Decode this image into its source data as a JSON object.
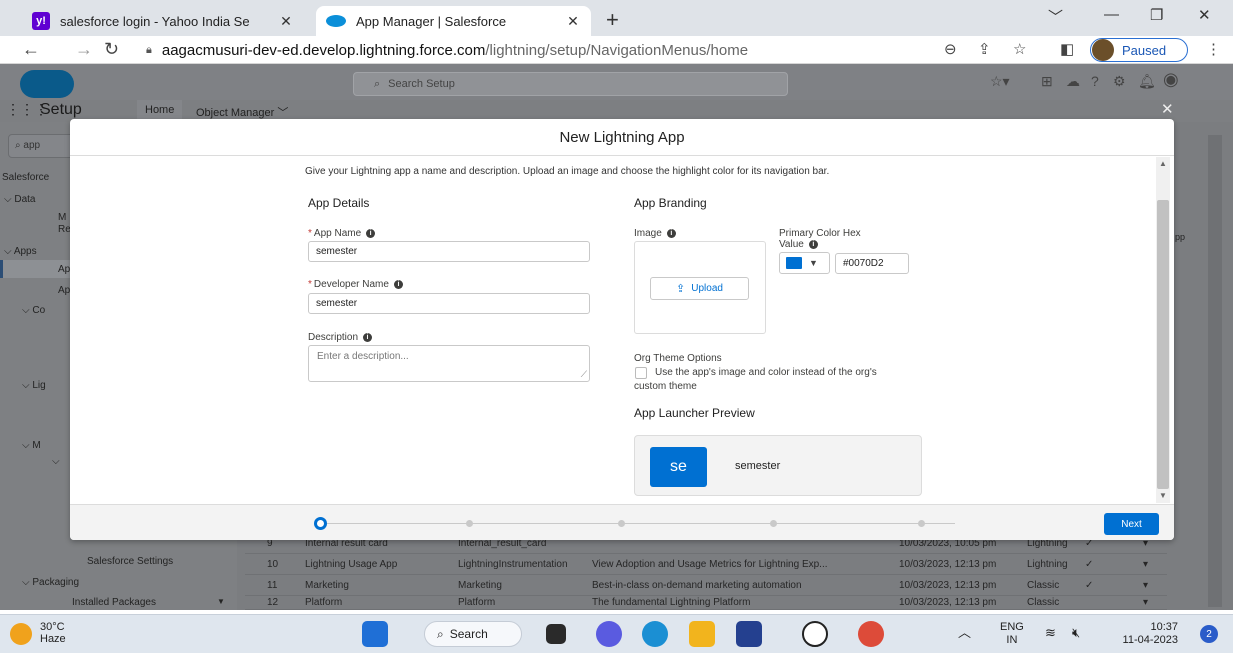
{
  "browser": {
    "tabs": [
      {
        "title": "salesforce login - Yahoo India Se",
        "favicon": "yahoo-icon"
      },
      {
        "title": "App Manager | Salesforce",
        "favicon": "salesforce-icon"
      }
    ],
    "url_host": "aagacmusuri-dev-ed.develop.lightning.force.com",
    "url_path": "/lightning/setup/NavigationMenus/home",
    "profile_status": "Paused"
  },
  "salesforce": {
    "search_placeholder": "Search Setup",
    "app_name": "Setup",
    "nav_tabs": [
      "Home",
      "Object Manager"
    ],
    "sidebar": {
      "search_value": "app",
      "breadcrumb": "Salesforce",
      "items": [
        {
          "label": "Data"
        },
        {
          "label": "M"
        },
        {
          "label": "Re"
        },
        {
          "label": "Apps"
        },
        {
          "label": "Ap"
        },
        {
          "label": "Ap"
        },
        {
          "label": "Co"
        },
        {
          "label": "Lig"
        },
        {
          "label": "M"
        },
        {
          "label": "Salesforce Settings"
        },
        {
          "label": "Packaging"
        },
        {
          "label": "Installed Packages"
        }
      ]
    },
    "table_rows": [
      {
        "num": "9",
        "label": "Internal result card",
        "api": "Internal_result_card",
        "desc": "",
        "date": "10/03/2023, 10:05 pm",
        "type": "Lightning",
        "check": "✓"
      },
      {
        "num": "10",
        "label": "Lightning Usage App",
        "api": "LightningInstrumentation",
        "desc": "View Adoption and Usage Metrics for Lightning Exp...",
        "date": "10/03/2023, 12:13 pm",
        "type": "Lightning",
        "check": "✓"
      },
      {
        "num": "11",
        "label": "Marketing",
        "api": "Marketing",
        "desc": "Best-in-class on-demand marketing automation",
        "date": "10/03/2023, 12:13 pm",
        "type": "Classic",
        "check": "✓"
      },
      {
        "num": "12",
        "label": "Platform",
        "api": "Platform",
        "desc": "The fundamental Lightning Platform",
        "date": "10/03/2023, 12:13 pm",
        "type": "Classic",
        "check": ""
      }
    ],
    "right_peek": "pp"
  },
  "modal": {
    "title": "New Lightning App",
    "description": "Give your Lightning app a name and description. Upload an image and choose the highlight color for its navigation bar.",
    "app_details": {
      "heading": "App Details",
      "app_name_label": "App Name",
      "app_name_value": "semester",
      "developer_name_label": "Developer Name",
      "developer_name_value": "semester",
      "description_label": "Description",
      "description_placeholder": "Enter a description..."
    },
    "app_branding": {
      "heading": "App Branding",
      "image_label": "Image",
      "upload_label": "Upload",
      "primary_color_label_1": "Primary Color Hex",
      "primary_color_label_2": "Value",
      "primary_color_value": "#0070D2",
      "primary_color": "#0070d2",
      "org_theme_label": "Org Theme Options",
      "org_theme_checkbox_line1": "Use the app's image and color instead of the org's",
      "org_theme_checkbox_line2": "custom theme",
      "org_theme_checked": false,
      "preview_heading": "App Launcher Preview",
      "preview_tile_text": "se",
      "preview_app_name": "semester"
    },
    "progress": {
      "current_step": 1,
      "total_steps": 5
    },
    "next_label": "Next"
  },
  "taskbar": {
    "temperature": "30°C",
    "weather": "Haze",
    "search_label": "Search",
    "language_1": "ENG",
    "language_2": "IN",
    "time": "10:37",
    "date": "11-04-2023",
    "notification_count": "2"
  }
}
